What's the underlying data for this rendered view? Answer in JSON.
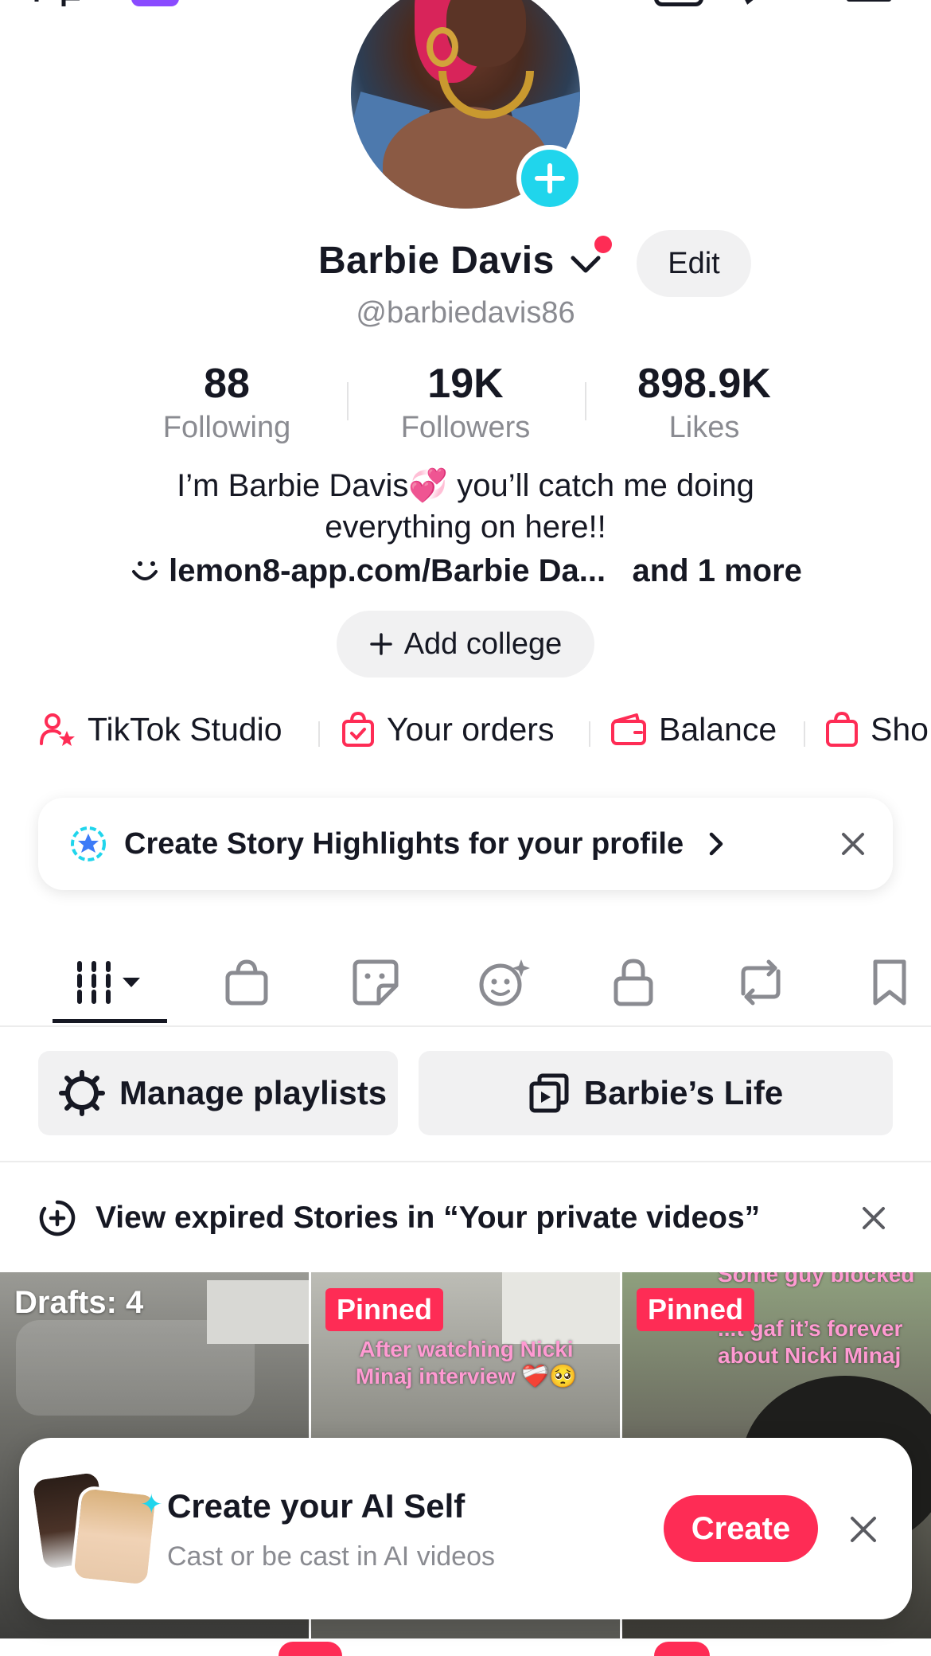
{
  "profile": {
    "name": "Barbie Davis",
    "handle": "@barbiedavis86",
    "edit_label": "Edit",
    "stats": [
      {
        "value": "88",
        "label": "Following"
      },
      {
        "value": "19K",
        "label": "Followers"
      },
      {
        "value": "898.9K",
        "label": "Likes"
      }
    ],
    "bio_line1": "I’m Barbie Davis💞 you’ll catch me doing",
    "bio_line2": "everything on here!!",
    "link_text": "lemon8-app.com/Barbie Da...",
    "link_more": "and 1 more",
    "add_college_label": "Add college"
  },
  "quick_links": [
    {
      "label": "TikTok Studio",
      "icon": "person-star-icon"
    },
    {
      "label": "Your orders",
      "icon": "bag-check-icon"
    },
    {
      "label": "Balance",
      "icon": "wallet-icon"
    },
    {
      "label": "Sho",
      "icon": "shopping-bag-icon"
    }
  ],
  "story_banner": {
    "text": "Create Story Highlights for your profile"
  },
  "tabs": [
    {
      "name": "videos",
      "icon": "grid-bars-icon",
      "active": true
    },
    {
      "name": "shop",
      "icon": "shopping-bag-icon"
    },
    {
      "name": "stickers",
      "icon": "sticker-icon"
    },
    {
      "name": "ai",
      "icon": "ai-face-icon"
    },
    {
      "name": "private",
      "icon": "lock-icon"
    },
    {
      "name": "reposts",
      "icon": "repost-icon"
    },
    {
      "name": "saved",
      "icon": "bookmark-icon"
    }
  ],
  "playlists": {
    "manage_label": "Manage playlists",
    "playlist_label": "Barbie’s Life"
  },
  "expired_stories": {
    "text": "View expired Stories in “Your private videos”"
  },
  "grid": [
    {
      "overlay": "Drafts: 4"
    },
    {
      "badge": "Pinned",
      "caption_line1": "After watching Nicki",
      "caption_line2": "Minaj interview ❤️‍🩹🥺"
    },
    {
      "badge": "Pinned",
      "caption_line1": "Some guy blocked me",
      "caption_line2": "...t gaf it’s forever",
      "caption_line3": "about Nicki Minaj"
    }
  ],
  "ai_self": {
    "title": "Create your AI Self",
    "subtitle": "Cast or be cast in AI videos",
    "create_label": "Create"
  },
  "colors": {
    "accent": "#fe2c55",
    "cyan": "#20d5ec",
    "text": "#161823",
    "muted": "#8a8b91",
    "chip_bg": "#f1f1f2"
  }
}
